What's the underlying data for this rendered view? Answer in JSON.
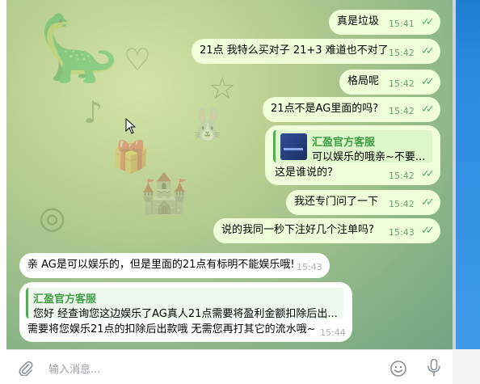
{
  "messages": [
    {
      "text": "真是垃圾",
      "time": "15:41"
    },
    {
      "text": "21点 我特么买对子 21+3  难道也不对了",
      "time": "15:42"
    },
    {
      "text": "格局呢",
      "time": "15:42"
    },
    {
      "text": "21点不是AG里面的吗?",
      "time": "15:42"
    },
    {
      "quote_name": "汇盈官方客服",
      "quote_text": "可以娱乐的哦亲~不要...",
      "text": "这是谁说的？",
      "time": "15:42"
    },
    {
      "text": "我还专门问了一下",
      "time": "15:42"
    },
    {
      "text": "说的我同一秒下注好几个注单吗?",
      "time": "15:43"
    },
    {
      "text": "亲 AG是可以娱乐的，但是里面的21点有标明不能娱乐哦!",
      "time": "15:43"
    },
    {
      "quote_name": "汇盈官方客服",
      "quote_text": "您好 经查询您这边娱乐了AG真人21点需要将盈利金额扣除后出...",
      "text": "需要将您娱乐21点的扣除后出款哦 无需您再打其它的流水哦~",
      "time": "15:44"
    }
  ],
  "input": {
    "placeholder": "输入消息..."
  },
  "icons": {
    "attach": "paperclip-icon",
    "emoji": "smiley-icon",
    "mic": "microphone-icon",
    "read": "double-check-icon"
  },
  "colors": {
    "outgoing_bubble": "#eefed8",
    "incoming_bubble": "#ffffff",
    "accent": "#4fae4e",
    "time_out": "#6aa56a"
  }
}
